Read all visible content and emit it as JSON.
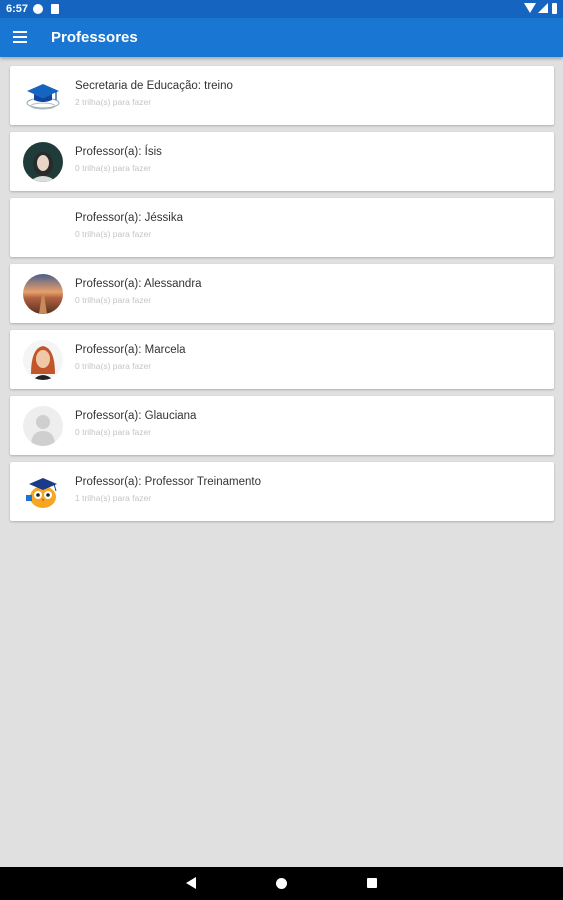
{
  "status_bar": {
    "time": "6:57",
    "notification_icons": [
      "p-badge-icon",
      "document-icon"
    ],
    "system_icons": [
      "wifi-icon",
      "signal-icon",
      "battery-icon"
    ]
  },
  "app_bar": {
    "menu_icon": "menu-icon",
    "title": "Professores",
    "color": "#1976d2"
  },
  "teachers": [
    {
      "name": "Secretaria de Educação: treino",
      "subtitle": "2 trilha(s) para fazer",
      "avatar": "graduation-cap-logo"
    },
    {
      "name": "Professor(a): Ísis",
      "subtitle": "0 trilha(s) para fazer",
      "avatar": "photo-portrait"
    },
    {
      "name": "Professor(a): Jéssika",
      "subtitle": "0 trilha(s) para fazer",
      "avatar": "none"
    },
    {
      "name": "Professor(a): Alessandra",
      "subtitle": "0 trilha(s) para fazer",
      "avatar": "photo-landscape"
    },
    {
      "name": "Professor(a): Marcela",
      "subtitle": "0 trilha(s) para fazer",
      "avatar": "photo-portrait"
    },
    {
      "name": "Professor(a): Glauciana",
      "subtitle": "0 trilha(s) para fazer",
      "avatar": "default-user-silhouette"
    },
    {
      "name": "Professor(a): Professor Treinamento",
      "subtitle": "1 trilha(s) para fazer",
      "avatar": "cartoon-owl-mascot"
    }
  ],
  "nav_bar": {
    "buttons": [
      "back-icon",
      "home-icon",
      "recents-icon"
    ]
  }
}
